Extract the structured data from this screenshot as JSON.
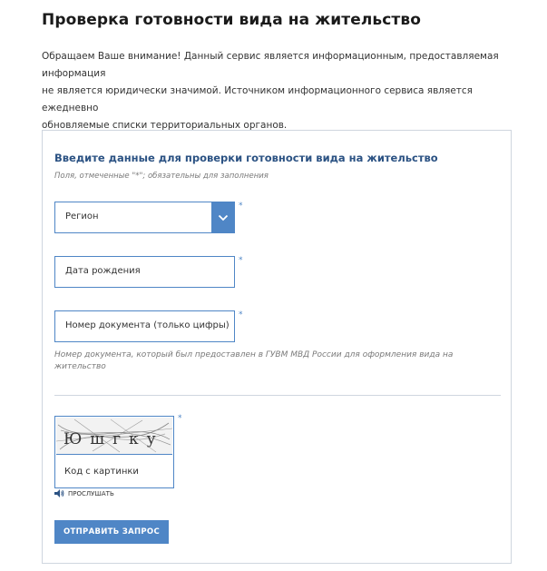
{
  "page": {
    "title": "Проверка готовности вида на жительство",
    "intro_lines": [
      "Обращаем Ваше внимание! Данный сервис является информационным, предоставляемая информация",
      "не является юридически значимой. Источником информационного сервиса является ежедневно",
      "обновляемые списки территориальных органов."
    ]
  },
  "form": {
    "title": "Введите данные для проверки готовности вида на жительство",
    "required_note": "Поля, отмеченные \"*\"; обязательны для заполнения",
    "required_mark": "*",
    "region": {
      "value": "Регион"
    },
    "birth_date": {
      "placeholder": "Дата рождения"
    },
    "document_number": {
      "placeholder": "Номер документа (только цифры)"
    },
    "document_hint": "Номер документа, который был предоставлен в ГУВМ МВД России для оформления вида на жительство",
    "captcha": {
      "image_text": "Юшгку",
      "input_placeholder": "Код с картинки",
      "listen_label": "ПРОСЛУШАТЬ"
    },
    "submit_label": "ОТПРАВИТЬ ЗАПРОС"
  },
  "colors": {
    "accent": "#4f86c6",
    "title_blue": "#2b5283",
    "border": "#cfd6df"
  },
  "icons": {
    "select_arrow": "chevron-down-icon",
    "audio": "speaker-icon"
  }
}
